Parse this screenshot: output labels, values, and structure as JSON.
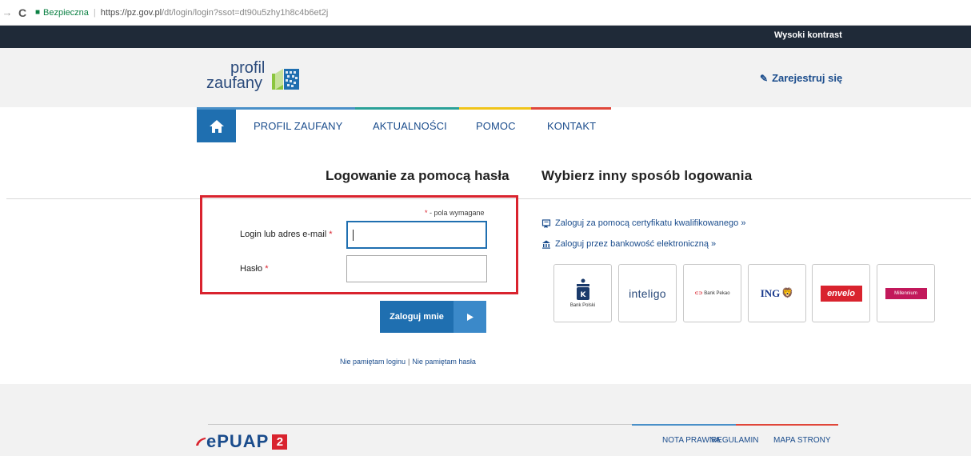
{
  "browser": {
    "secure_label": "Bezpieczna",
    "url_main": "https://pz.gov.pl",
    "url_path": "/dt/login/login?ssot=dt90u5zhy1h8c4b6et2j"
  },
  "topbar": {
    "high_contrast": "Wysoki kontrast"
  },
  "header": {
    "logo_line1": "profil",
    "logo_line2": "zaufany",
    "register": "Zarejestruj się"
  },
  "nav": {
    "items": [
      "PROFIL ZAUFANY",
      "AKTUALNOŚCI",
      "POMOC",
      "KONTAKT"
    ]
  },
  "login": {
    "heading": "Logowanie za pomocą hasła",
    "required_star": "*",
    "required_note": " - pola wymagane",
    "login_label": "Login lub adres e-mail",
    "login_value": "",
    "password_label": "Hasło",
    "password_value": "",
    "submit": "Zaloguj mnie",
    "forgot_login": "Nie pamiętam loginu",
    "forgot_sep": "|",
    "forgot_password": "Nie pamiętam hasła"
  },
  "alternative": {
    "heading": "Wybierz inny sposób logowania",
    "certificate": "Zaloguj za pomocą certyfikatu kwalifikowanego »",
    "bank": "Zaloguj przez bankowość elektroniczną »",
    "banks": [
      "Bank Polski",
      "inteligo",
      "Bank Pekao",
      "ING",
      "envelo",
      "Millennium"
    ]
  },
  "footer": {
    "brand": "ePUAP",
    "brand_number": "2",
    "links": [
      "NOTA PRAWNA",
      "REGULAMIN",
      "MAPA STRONY"
    ]
  },
  "colors": {
    "brand_blue": "#1f6fb0",
    "dark": "#1f2a38",
    "accent_red": "#d9232e",
    "bar_blue": "#4a90c8",
    "bar_teal": "#2aa198",
    "bar_yellow": "#f0c419",
    "bar_red": "#e0473a"
  }
}
